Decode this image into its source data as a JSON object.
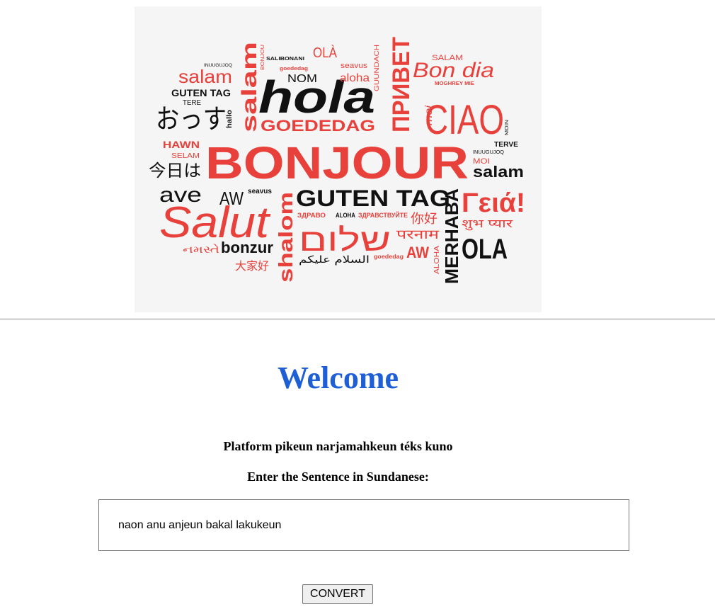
{
  "hero_image": {
    "colors": {
      "red": "#e8413c",
      "black": "#111111",
      "background": "#f5f5f5"
    },
    "words": [
      {
        "text": "BONJOUR",
        "color": "red"
      },
      {
        "text": "hola",
        "color": "black"
      },
      {
        "text": "CIAO",
        "color": "red"
      },
      {
        "text": "Bon dia",
        "color": "red"
      },
      {
        "text": "ПРИВЕТ",
        "color": "red"
      },
      {
        "text": "salam",
        "color": "red"
      },
      {
        "text": "salam",
        "color": "red"
      },
      {
        "text": "salam",
        "color": "black"
      },
      {
        "text": "GUTEN TAG",
        "color": "black"
      },
      {
        "text": "GUTEN TAG",
        "color": "black"
      },
      {
        "text": "GOEDEDAG",
        "color": "red"
      },
      {
        "text": "おっす",
        "color": "black"
      },
      {
        "text": "今日は",
        "color": "black"
      },
      {
        "text": "Salut",
        "color": "red"
      },
      {
        "text": "ave",
        "color": "black"
      },
      {
        "text": "AW",
        "color": "black"
      },
      {
        "text": "AW",
        "color": "red"
      },
      {
        "text": "Γειά!",
        "color": "red"
      },
      {
        "text": "shalom",
        "color": "red"
      },
      {
        "text": "MERHABA",
        "color": "black"
      },
      {
        "text": "OLA",
        "color": "black"
      },
      {
        "text": "OLÀ",
        "color": "red"
      },
      {
        "text": "NOM",
        "color": "black"
      },
      {
        "text": "aloha",
        "color": "red"
      },
      {
        "text": "seavus",
        "color": "red"
      },
      {
        "text": "seavus",
        "color": "black"
      },
      {
        "text": "HAWN",
        "color": "red"
      },
      {
        "text": "SELAM",
        "color": "red"
      },
      {
        "text": "SALAM",
        "color": "red"
      },
      {
        "text": "TERE",
        "color": "black"
      },
      {
        "text": "TERVE",
        "color": "black"
      },
      {
        "text": "MOI",
        "color": "red"
      },
      {
        "text": "moi",
        "color": "red"
      },
      {
        "text": "MOGHREY MIE",
        "color": "red"
      },
      {
        "text": "INUUGUJOQ",
        "color": "black"
      },
      {
        "text": "INUUGUJOQ",
        "color": "black"
      },
      {
        "text": "SALIBONANI",
        "color": "black"
      },
      {
        "text": "goededag",
        "color": "red"
      },
      {
        "text": "goededag",
        "color": "red"
      },
      {
        "text": "GUUNDACH",
        "color": "red"
      },
      {
        "text": "BONJOU",
        "color": "red"
      },
      {
        "text": "hallo",
        "color": "black"
      },
      {
        "text": "bonzur",
        "color": "black"
      },
      {
        "text": "નમસ્તે",
        "color": "red"
      },
      {
        "text": "大家好",
        "color": "red"
      },
      {
        "text": "你好",
        "color": "red"
      },
      {
        "text": "परनाम",
        "color": "red"
      },
      {
        "text": "शुभ प्यार",
        "color": "red"
      },
      {
        "text": "שלום",
        "color": "red"
      },
      {
        "text": "ЗДРАВО",
        "color": "red"
      },
      {
        "text": "ALOHA",
        "color": "black"
      },
      {
        "text": "ЗДРАВСТВУЙТЕ",
        "color": "red"
      },
      {
        "text": "ALOHA",
        "color": "red"
      },
      {
        "text": "MOIN",
        "color": "black"
      },
      {
        "text": "السلام عليكم",
        "color": "black"
      }
    ]
  },
  "page": {
    "title": "Welcome",
    "subtitle": "Platform pikeun narjamahkeun téks kuno",
    "prompt": "Enter the Sentence in Sundanese:"
  },
  "form": {
    "sentence_value": "naon anu anjeun bakal lakukeun",
    "convert_label": "CONVERT"
  }
}
